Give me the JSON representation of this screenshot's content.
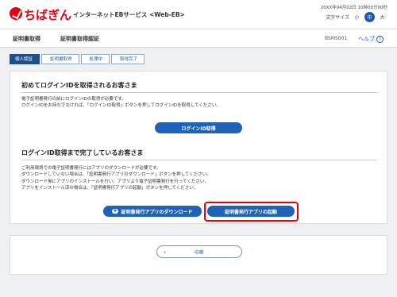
{
  "header": {
    "brand": "ちばぎん",
    "service": "インターネットEBサービス <Web-EB>",
    "datetime": "20XX年04月02日 10時00分00秒",
    "font_size_label": "文字サイズ",
    "font_sizes": [
      "小",
      "中",
      "大"
    ],
    "accent": "#e60012"
  },
  "nav": {
    "tab1": "証明書取得",
    "tab2": "証明書取得認証",
    "screen_id": "BSMS001",
    "help": "ヘルプ"
  },
  "steps": [
    "個人認証",
    "証明書取得",
    "処理中",
    "取得完了"
  ],
  "section1": {
    "title": "初めてログインIDを取得されるお客さま",
    "lines": [
      "電子証明書発行の前にログインIDの取得が必要です。",
      "ログインIDをお持ちでなければ、「ログインID取得」ボタンを押してログインIDを取得してください。"
    ],
    "button": "ログインID取得"
  },
  "section2": {
    "title": "ログインID取得まで完了しているお客さま",
    "lines": [
      "ご利用環境での電子証明書発行にはアプリのダウンロードが必要です。",
      "ダウンロードしていない場合は、「証明書発行アプリのダウンロード」ボタンを押してください。",
      "ダウンロード後にアプリのインストールを行い、アプリより電子証明書発行を行ってください。",
      "アプリをインストール済の場合は、「証明書発行アプリの起動」ボタンを押してください。"
    ],
    "download_button": "証明書発行アプリのダウンロード",
    "launch_button": "証明書発行アプリの起動"
  },
  "footer": {
    "cancel_button": "中断"
  }
}
